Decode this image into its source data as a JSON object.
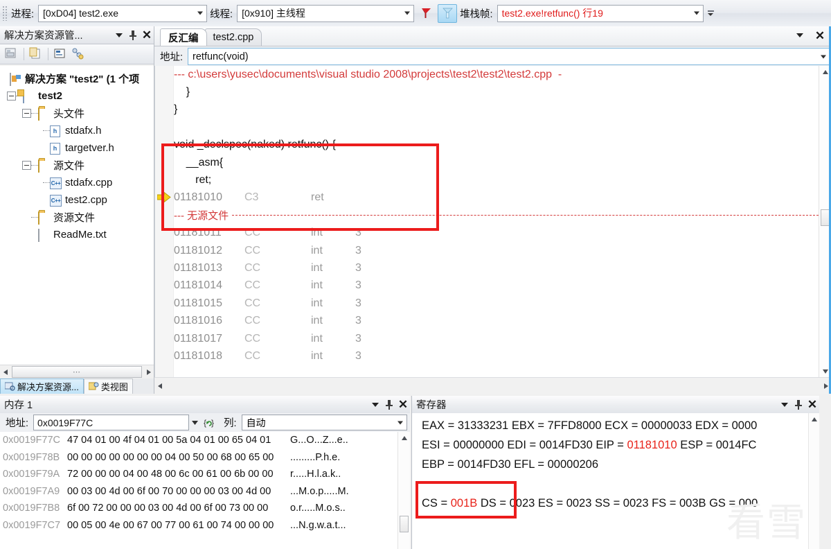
{
  "debug_toolbar": {
    "process_label": "进程:",
    "process_value": "[0xD04] test2.exe",
    "thread_label": "线程:",
    "thread_value": "[0x910] 主线程",
    "frame_label": "堆栈帧:",
    "frame_value": "test2.exe!retfunc()  行19",
    "flag_icon": "flag-red-icon",
    "flag_icon_active": "flag-blue-icon"
  },
  "solution_explorer": {
    "title": "解决方案资源管...",
    "toolbar_icons": [
      "properties-icon",
      "show-all-files-icon",
      "view-code-icon",
      "class-view-icon"
    ],
    "tree": [
      {
        "label": "解决方案 \"test2\" (1 个项",
        "icon": "solution-icon",
        "indent": 0,
        "bold": false,
        "expander": false
      },
      {
        "label": "test2",
        "icon": "project-icon",
        "indent": 1,
        "bold": true,
        "expander": true
      },
      {
        "label": "头文件",
        "icon": "folder-icon",
        "indent": 2,
        "bold": false,
        "expander": true
      },
      {
        "label": "stdafx.h",
        "icon": "header-file-icon",
        "indent": 3,
        "bold": false,
        "expander": false
      },
      {
        "label": "targetver.h",
        "icon": "header-file-icon",
        "indent": 3,
        "bold": false,
        "expander": false
      },
      {
        "label": "源文件",
        "icon": "folder-icon",
        "indent": 2,
        "bold": false,
        "expander": true
      },
      {
        "label": "stdafx.cpp",
        "icon": "cpp-file-icon",
        "indent": 3,
        "bold": false,
        "expander": false
      },
      {
        "label": "test2.cpp",
        "icon": "cpp-file-icon",
        "indent": 3,
        "bold": false,
        "expander": false
      },
      {
        "label": "资源文件",
        "icon": "folder-icon",
        "indent": 2,
        "bold": false,
        "expander": false
      },
      {
        "label": "ReadMe.txt",
        "icon": "text-file-icon",
        "indent": 2,
        "bold": false,
        "expander": false
      }
    ],
    "tabs": [
      {
        "label": "解决方案资源...",
        "icon": "solution-explorer-icon",
        "active": true
      },
      {
        "label": "类视图",
        "icon": "class-view-icon",
        "active": false
      }
    ]
  },
  "disassembly": {
    "tabs": [
      {
        "label": "反汇编",
        "active": true
      },
      {
        "label": "test2.cpp",
        "active": false
      }
    ],
    "address_label": "地址:",
    "address_value": "retfunc(void)",
    "source_header": "--- c:\\users\\yusec\\documents\\visual studio 2008\\projects\\test2\\test2\\test2.cpp  -",
    "no_source_label": "--- 无源文件",
    "lines": [
      {
        "kind": "source",
        "text": "    }"
      },
      {
        "kind": "source",
        "text": "}"
      },
      {
        "kind": "blank",
        "text": ""
      },
      {
        "kind": "source",
        "text": "void _declspec(naked) retfunc() {"
      },
      {
        "kind": "source",
        "text": "    __asm{"
      },
      {
        "kind": "source",
        "text": "       ret;"
      }
    ],
    "current_instruction": {
      "address": "01181010",
      "bytes": "C3",
      "mnemonic": "ret",
      "marker_icon": "current-statement-arrow-icon"
    },
    "asm_rows": [
      {
        "address": "01181011",
        "bytes": "CC",
        "mnemonic": "int",
        "operand": "3"
      },
      {
        "address": "01181012",
        "bytes": "CC",
        "mnemonic": "int",
        "operand": "3"
      },
      {
        "address": "01181013",
        "bytes": "CC",
        "mnemonic": "int",
        "operand": "3"
      },
      {
        "address": "01181014",
        "bytes": "CC",
        "mnemonic": "int",
        "operand": "3"
      },
      {
        "address": "01181015",
        "bytes": "CC",
        "mnemonic": "int",
        "operand": "3"
      },
      {
        "address": "01181016",
        "bytes": "CC",
        "mnemonic": "int",
        "operand": "3"
      },
      {
        "address": "01181017",
        "bytes": "CC",
        "mnemonic": "int",
        "operand": "3"
      },
      {
        "address": "01181018",
        "bytes": "CC",
        "mnemonic": "int",
        "operand": "3"
      }
    ]
  },
  "memory": {
    "title": "内存 1",
    "address_label": "地址:",
    "address_value": "0x0019F77C",
    "reload_icon": "reevaluate-icon",
    "columns_label": "列:",
    "columns_value": "自动",
    "rows": [
      {
        "address": "0x0019F77C",
        "hex": "47 04 01 00 4f 04 01 00 5a 04 01 00 65 04 01",
        "ascii": "G...O...Z...e.."
      },
      {
        "address": "0x0019F78B",
        "hex": "00 00 00 00 00 00 00 04 00 50 00 68 00 65 00",
        "ascii": ".........P.h.e."
      },
      {
        "address": "0x0019F79A",
        "hex": "72 00 00 00 04 00 48 00 6c 00 61 00 6b 00 00",
        "ascii": "r.....H.l.a.k.."
      },
      {
        "address": "0x0019F7A9",
        "hex": "00 03 00 4d 00 6f 00 70 00 00 00 03 00 4d 00",
        "ascii": "...M.o.p.....M."
      },
      {
        "address": "0x0019F7B8",
        "hex": "6f 00 72 00 00 00 03 00 4d 00 6f 00 73 00 00",
        "ascii": "o.r.....M.o.s.."
      },
      {
        "address": "0x0019F7C7",
        "hex": "00 05 00 4e 00 67 00 77 00 61 00 74 00 00 00",
        "ascii": "...N.g.w.a.t..."
      }
    ]
  },
  "registers": {
    "title": "寄存器",
    "lines": [
      [
        {
          "text": "EAX = 31333231 EBX = 7FFD8000 ECX = 00000033 EDX = 0000",
          "hot": false
        }
      ],
      [
        {
          "text": "ESI = 00000000 EDI = 0014FD30 EIP = ",
          "hot": false
        },
        {
          "text": "01181010",
          "hot": true
        },
        {
          "text": " ESP = 0014FC",
          "hot": false
        }
      ],
      [
        {
          "text": "EBP = 0014FD30 EFL = 00000206",
          "hot": false
        }
      ],
      [
        {
          "text": "",
          "hot": false
        }
      ],
      [
        {
          "text": "CS = ",
          "hot": false
        },
        {
          "text": "001B",
          "hot": true
        },
        {
          "text": " DS = 0023 ES = 0023 SS = 0023 FS = 003B GS = 000",
          "hot": false
        }
      ]
    ],
    "watermark": "看雪"
  },
  "annotations": [
    {
      "name": "naked-function-highlight",
      "color": "#ec1c1c"
    },
    {
      "name": "cs-register-highlight",
      "color": "#ec1c1c"
    }
  ],
  "colors": {
    "accent_red": "#ec1c1c",
    "source_red": "#d33a3a",
    "asm_gray": "#9a9a9a",
    "selection_blue": "#4aa8e8"
  }
}
